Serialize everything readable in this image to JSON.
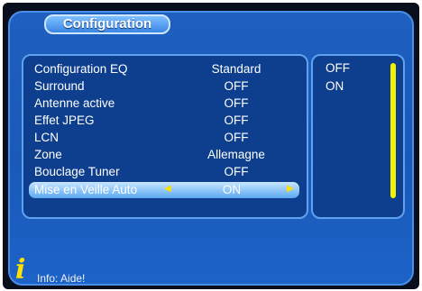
{
  "title": "Configuration",
  "menu_items": [
    {
      "label": "Configuration EQ",
      "value": "Standard"
    },
    {
      "label": "Surround",
      "value": "OFF"
    },
    {
      "label": "Antenne active",
      "value": "OFF"
    },
    {
      "label": "Effet JPEG",
      "value": "OFF"
    },
    {
      "label": "LCN",
      "value": "OFF"
    },
    {
      "label": "Zone",
      "value": "Allemagne"
    },
    {
      "label": "Bouclage Tuner",
      "value": "OFF"
    },
    {
      "label": "Mise en Veille Auto",
      "value": "ON",
      "selected": true
    }
  ],
  "options": [
    "OFF",
    "ON"
  ],
  "info": "Info: Aide!",
  "colors": {
    "background": "#1f5fbf",
    "panel": "#0e3f8e",
    "highlight": "#5aa8f2",
    "accent": "#ffe000"
  },
  "icons": {
    "info": "info-icon",
    "left": "arrow-left-icon",
    "right": "arrow-right-icon"
  }
}
